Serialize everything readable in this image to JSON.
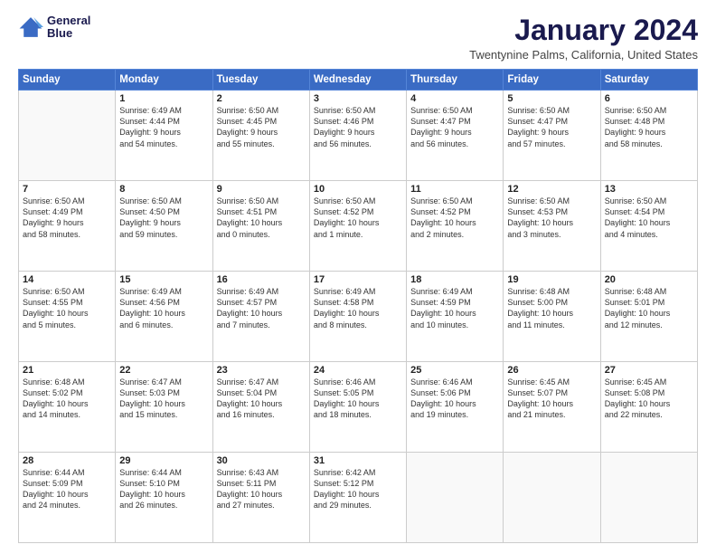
{
  "logo": {
    "line1": "General",
    "line2": "Blue"
  },
  "title": "January 2024",
  "subtitle": "Twentynine Palms, California, United States",
  "weekdays": [
    "Sunday",
    "Monday",
    "Tuesday",
    "Wednesday",
    "Thursday",
    "Friday",
    "Saturday"
  ],
  "weeks": [
    [
      {
        "day": "",
        "info": ""
      },
      {
        "day": "1",
        "info": "Sunrise: 6:49 AM\nSunset: 4:44 PM\nDaylight: 9 hours\nand 54 minutes."
      },
      {
        "day": "2",
        "info": "Sunrise: 6:50 AM\nSunset: 4:45 PM\nDaylight: 9 hours\nand 55 minutes."
      },
      {
        "day": "3",
        "info": "Sunrise: 6:50 AM\nSunset: 4:46 PM\nDaylight: 9 hours\nand 56 minutes."
      },
      {
        "day": "4",
        "info": "Sunrise: 6:50 AM\nSunset: 4:47 PM\nDaylight: 9 hours\nand 56 minutes."
      },
      {
        "day": "5",
        "info": "Sunrise: 6:50 AM\nSunset: 4:47 PM\nDaylight: 9 hours\nand 57 minutes."
      },
      {
        "day": "6",
        "info": "Sunrise: 6:50 AM\nSunset: 4:48 PM\nDaylight: 9 hours\nand 58 minutes."
      }
    ],
    [
      {
        "day": "7",
        "info": "Sunrise: 6:50 AM\nSunset: 4:49 PM\nDaylight: 9 hours\nand 58 minutes."
      },
      {
        "day": "8",
        "info": "Sunrise: 6:50 AM\nSunset: 4:50 PM\nDaylight: 9 hours\nand 59 minutes."
      },
      {
        "day": "9",
        "info": "Sunrise: 6:50 AM\nSunset: 4:51 PM\nDaylight: 10 hours\nand 0 minutes."
      },
      {
        "day": "10",
        "info": "Sunrise: 6:50 AM\nSunset: 4:52 PM\nDaylight: 10 hours\nand 1 minute."
      },
      {
        "day": "11",
        "info": "Sunrise: 6:50 AM\nSunset: 4:52 PM\nDaylight: 10 hours\nand 2 minutes."
      },
      {
        "day": "12",
        "info": "Sunrise: 6:50 AM\nSunset: 4:53 PM\nDaylight: 10 hours\nand 3 minutes."
      },
      {
        "day": "13",
        "info": "Sunrise: 6:50 AM\nSunset: 4:54 PM\nDaylight: 10 hours\nand 4 minutes."
      }
    ],
    [
      {
        "day": "14",
        "info": "Sunrise: 6:50 AM\nSunset: 4:55 PM\nDaylight: 10 hours\nand 5 minutes."
      },
      {
        "day": "15",
        "info": "Sunrise: 6:49 AM\nSunset: 4:56 PM\nDaylight: 10 hours\nand 6 minutes."
      },
      {
        "day": "16",
        "info": "Sunrise: 6:49 AM\nSunset: 4:57 PM\nDaylight: 10 hours\nand 7 minutes."
      },
      {
        "day": "17",
        "info": "Sunrise: 6:49 AM\nSunset: 4:58 PM\nDaylight: 10 hours\nand 8 minutes."
      },
      {
        "day": "18",
        "info": "Sunrise: 6:49 AM\nSunset: 4:59 PM\nDaylight: 10 hours\nand 10 minutes."
      },
      {
        "day": "19",
        "info": "Sunrise: 6:48 AM\nSunset: 5:00 PM\nDaylight: 10 hours\nand 11 minutes."
      },
      {
        "day": "20",
        "info": "Sunrise: 6:48 AM\nSunset: 5:01 PM\nDaylight: 10 hours\nand 12 minutes."
      }
    ],
    [
      {
        "day": "21",
        "info": "Sunrise: 6:48 AM\nSunset: 5:02 PM\nDaylight: 10 hours\nand 14 minutes."
      },
      {
        "day": "22",
        "info": "Sunrise: 6:47 AM\nSunset: 5:03 PM\nDaylight: 10 hours\nand 15 minutes."
      },
      {
        "day": "23",
        "info": "Sunrise: 6:47 AM\nSunset: 5:04 PM\nDaylight: 10 hours\nand 16 minutes."
      },
      {
        "day": "24",
        "info": "Sunrise: 6:46 AM\nSunset: 5:05 PM\nDaylight: 10 hours\nand 18 minutes."
      },
      {
        "day": "25",
        "info": "Sunrise: 6:46 AM\nSunset: 5:06 PM\nDaylight: 10 hours\nand 19 minutes."
      },
      {
        "day": "26",
        "info": "Sunrise: 6:45 AM\nSunset: 5:07 PM\nDaylight: 10 hours\nand 21 minutes."
      },
      {
        "day": "27",
        "info": "Sunrise: 6:45 AM\nSunset: 5:08 PM\nDaylight: 10 hours\nand 22 minutes."
      }
    ],
    [
      {
        "day": "28",
        "info": "Sunrise: 6:44 AM\nSunset: 5:09 PM\nDaylight: 10 hours\nand 24 minutes."
      },
      {
        "day": "29",
        "info": "Sunrise: 6:44 AM\nSunset: 5:10 PM\nDaylight: 10 hours\nand 26 minutes."
      },
      {
        "day": "30",
        "info": "Sunrise: 6:43 AM\nSunset: 5:11 PM\nDaylight: 10 hours\nand 27 minutes."
      },
      {
        "day": "31",
        "info": "Sunrise: 6:42 AM\nSunset: 5:12 PM\nDaylight: 10 hours\nand 29 minutes."
      },
      {
        "day": "",
        "info": ""
      },
      {
        "day": "",
        "info": ""
      },
      {
        "day": "",
        "info": ""
      }
    ]
  ]
}
